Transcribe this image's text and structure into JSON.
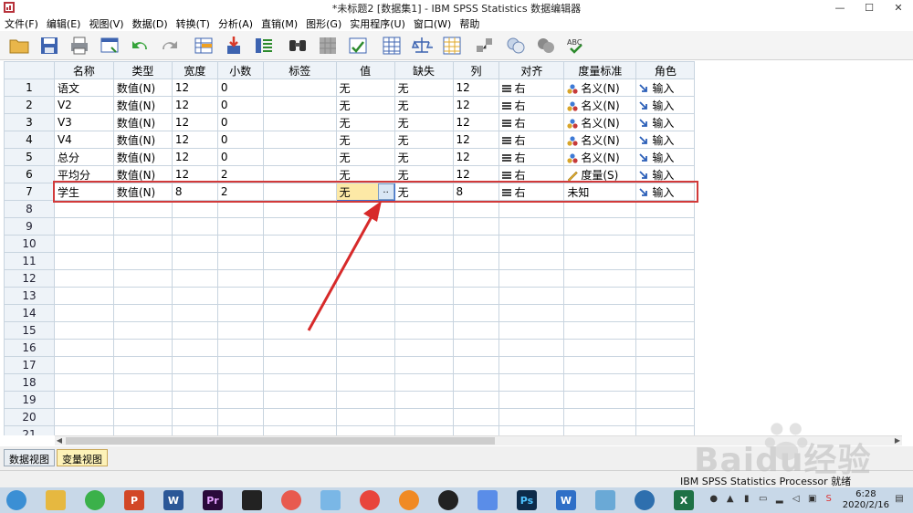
{
  "window": {
    "title": "*未标题2 [数据集1] - IBM SPSS Statistics 数据编辑器",
    "controls": [
      "—",
      "☐",
      "✕"
    ]
  },
  "menu": [
    "文件(F)",
    "编辑(E)",
    "视图(V)",
    "数据(D)",
    "转换(T)",
    "分析(A)",
    "直销(M)",
    "图形(G)",
    "实用程序(U)",
    "窗口(W)",
    "帮助"
  ],
  "toolbar_icons": [
    "open-folder",
    "save",
    "print",
    "recall-dialog",
    "undo",
    "redo",
    "goto-case",
    "goto-variable",
    "variables",
    "find",
    "insert-cases",
    "insert-variable",
    "split-file",
    "weight-cases",
    "select-cases",
    "value-labels",
    "use-sets",
    "show-all-variables",
    "spell-check"
  ],
  "grid": {
    "columns": [
      "名称",
      "类型",
      "宽度",
      "小数",
      "标签",
      "值",
      "缺失",
      "列",
      "对齐",
      "度量标准",
      "角色"
    ],
    "rows": [
      {
        "n": "1",
        "name": "语文",
        "type": "数值(N)",
        "width": "12",
        "decimals": "0",
        "label": "",
        "values": "无",
        "missing": "无",
        "columns": "12",
        "align": "右",
        "measure": "名义(N)",
        "role": "输入"
      },
      {
        "n": "2",
        "name": "V2",
        "type": "数值(N)",
        "width": "12",
        "decimals": "0",
        "label": "",
        "values": "无",
        "missing": "无",
        "columns": "12",
        "align": "右",
        "measure": "名义(N)",
        "role": "输入"
      },
      {
        "n": "3",
        "name": "V3",
        "type": "数值(N)",
        "width": "12",
        "decimals": "0",
        "label": "",
        "values": "无",
        "missing": "无",
        "columns": "12",
        "align": "右",
        "measure": "名义(N)",
        "role": "输入"
      },
      {
        "n": "4",
        "name": "V4",
        "type": "数值(N)",
        "width": "12",
        "decimals": "0",
        "label": "",
        "values": "无",
        "missing": "无",
        "columns": "12",
        "align": "右",
        "measure": "名义(N)",
        "role": "输入"
      },
      {
        "n": "5",
        "name": "总分",
        "type": "数值(N)",
        "width": "12",
        "decimals": "0",
        "label": "",
        "values": "无",
        "missing": "无",
        "columns": "12",
        "align": "右",
        "measure": "名义(N)",
        "role": "输入"
      },
      {
        "n": "6",
        "name": "平均分",
        "type": "数值(N)",
        "width": "12",
        "decimals": "2",
        "label": "",
        "values": "无",
        "missing": "无",
        "columns": "12",
        "align": "右",
        "measure": "度量(S)",
        "role": "输入"
      },
      {
        "n": "7",
        "name": "学生",
        "type": "数值(N)",
        "width": "8",
        "decimals": "2",
        "label": "",
        "values": "无",
        "missing": "无",
        "columns": "8",
        "align": "右",
        "measure": "未知",
        "role": "输入"
      }
    ],
    "empty_rows": [
      "8",
      "9",
      "10",
      "11",
      "12",
      "13",
      "14",
      "15",
      "16",
      "17",
      "18",
      "19",
      "20",
      "21"
    ],
    "dots_label": "..",
    "colors": {
      "header_bg": "#eef3f8",
      "grid_line": "#c8d4df",
      "selected_bg": "#fde9a6",
      "highlight": "#d23a3a"
    }
  },
  "tabs": [
    {
      "label": "数据视图",
      "active": false
    },
    {
      "label": "变量视图",
      "active": true
    }
  ],
  "status": "IBM SPSS Statistics Processor 就绪",
  "taskbar": {
    "apps": [
      "start",
      "explorer",
      "wechat",
      "powerpoint",
      "word",
      "premiere",
      "video",
      "meitu",
      "notes",
      "chrome",
      "browser",
      "qq",
      "feishu",
      "photoshop",
      "word-alt",
      "tool",
      "mathtype",
      "excel"
    ],
    "time": "6:28",
    "date": "2020/2/16"
  },
  "watermark": "Baidu经验"
}
